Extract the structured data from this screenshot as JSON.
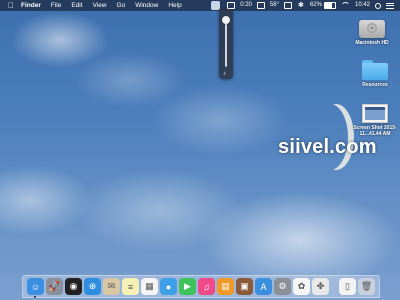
{
  "menubar": {
    "apple_icon": "apple-icon",
    "items": [
      "Finder",
      "File",
      "Edit",
      "View",
      "Go",
      "Window",
      "Help"
    ],
    "status": {
      "timer": "0:20",
      "temperature": "58°",
      "battery_pct": "62%",
      "clock": "10:42"
    }
  },
  "volume_slider": {
    "level": 0.95
  },
  "desktop_icons": [
    {
      "label": "Macintosh HD",
      "icon": "hard-drive-icon"
    },
    {
      "label": "Resources",
      "icon": "folder-icon"
    },
    {
      "label": "Screen Shot 2015-11...41.44 AM",
      "icon": "screenshot-file-icon"
    }
  ],
  "watermark": "siivel.com",
  "dock": {
    "apps": [
      {
        "name": "Finder",
        "icon": "finder-icon",
        "color": "#3a8fe0",
        "glyph": "☺"
      },
      {
        "name": "Launchpad",
        "icon": "launchpad-icon",
        "color": "#8a8f9a",
        "glyph": "🚀"
      },
      {
        "name": "Dashboard",
        "icon": "dashboard-icon",
        "color": "#222222",
        "glyph": "◉"
      },
      {
        "name": "Safari",
        "icon": "safari-icon",
        "color": "#2f8de0",
        "glyph": "⊕"
      },
      {
        "name": "Mail",
        "icon": "mail-icon",
        "color": "#d9c7a4",
        "glyph": "✉"
      },
      {
        "name": "Notes",
        "icon": "notes-icon",
        "color": "#f7f0b5",
        "glyph": "≡"
      },
      {
        "name": "Calendar",
        "icon": "calendar-icon",
        "color": "#f4f4f4",
        "glyph": "▦"
      },
      {
        "name": "Messages",
        "icon": "messages-icon",
        "color": "#3fa0e8",
        "glyph": "●"
      },
      {
        "name": "FaceTime",
        "icon": "facetime-icon",
        "color": "#3cc35a",
        "glyph": "▶"
      },
      {
        "name": "iTunes",
        "icon": "itunes-icon",
        "color": "#f04a8a",
        "glyph": "♫"
      },
      {
        "name": "iBooks",
        "icon": "ibooks-icon",
        "color": "#f19a2a",
        "glyph": "▤"
      },
      {
        "name": "Photo Booth",
        "icon": "photo-booth-icon",
        "color": "#8a5a3a",
        "glyph": "▣"
      },
      {
        "name": "App Store",
        "icon": "app-store-icon",
        "color": "#3a8fe0",
        "glyph": "A"
      },
      {
        "name": "System Preferences",
        "icon": "system-preferences-icon",
        "color": "#8b8f96",
        "glyph": "⚙"
      },
      {
        "name": "Photos",
        "icon": "photos-icon",
        "color": "#f6f6f6",
        "glyph": "✿"
      },
      {
        "name": "Sheep",
        "icon": "sheep-icon",
        "color": "#e8e8e8",
        "glyph": "✤"
      }
    ],
    "downloads": {
      "name": "Downloads",
      "icon": "document-stack-icon",
      "color": "#f2f2f2",
      "glyph": "▯"
    },
    "trash": {
      "name": "Trash",
      "icon": "trash-icon",
      "color": "#c7d0dc",
      "glyph": "🗑"
    }
  }
}
